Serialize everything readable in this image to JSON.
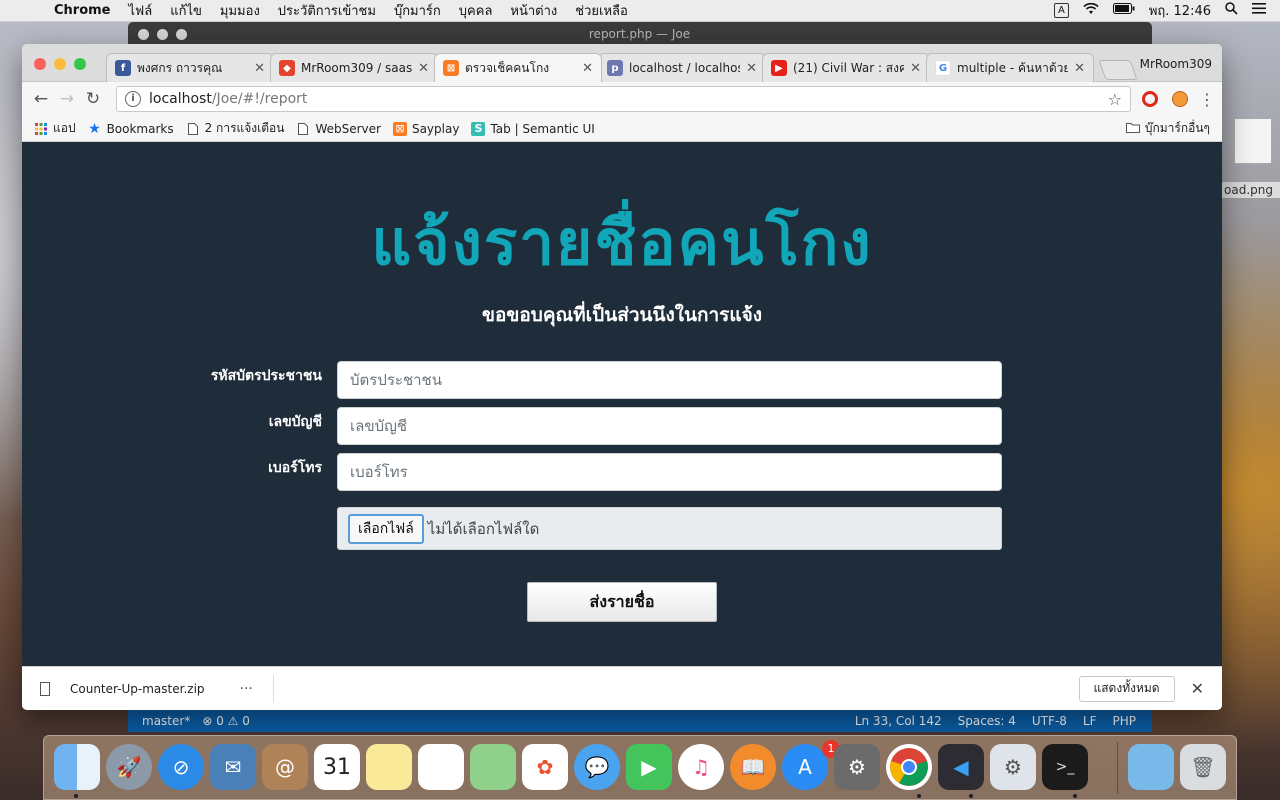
{
  "menubar": {
    "app": "Chrome",
    "items": [
      "ไฟล์",
      "แก้ไข",
      "มุมมอง",
      "ประวัติการเข้าชม",
      "บุ๊กมาร์ก",
      "บุคคล",
      "หน้าต่าง",
      "ช่วยเหลือ"
    ],
    "input_indicator": "A",
    "clock": "พฤ. 12:46"
  },
  "editor": {
    "title": "report.php — Joe",
    "status_left": [
      "master*",
      "⊗ 0 ⚠ 0"
    ],
    "status_right": [
      "Ln 33, Col 142",
      "Spaces: 4",
      "UTF-8",
      "LF",
      "PHP"
    ]
  },
  "chrome": {
    "profile": "MrRoom309",
    "tabs": [
      {
        "label": "พงศกร ถาวรคุณ",
        "icon": "facebook-icon",
        "color": "#3b5998"
      },
      {
        "label": "MrRoom309 / saas",
        "icon": "gitlab-icon",
        "color": "#e24329"
      },
      {
        "label": "ตรวจเช็คคนโกง",
        "icon": "xampp-icon",
        "color": "#fb7a24",
        "active": true
      },
      {
        "label": "localhost / localhos",
        "icon": "phpmyadmin-icon",
        "color": "#6c78af"
      },
      {
        "label": "(21) Civil War : สงคร",
        "icon": "youtube-icon",
        "color": "#e62117"
      },
      {
        "label": "multiple - ค้นหาด้วย",
        "icon": "google-icon",
        "color": "#4285f4"
      }
    ],
    "url_host": "localhost",
    "url_path": "/Joe/#!/report",
    "bookmarks": [
      {
        "label": "แอป",
        "icon": "apps-grid-icon"
      },
      {
        "label": "Bookmarks",
        "icon": "star-icon"
      },
      {
        "label": "2 การแจ้งเตือน",
        "icon": "page-icon"
      },
      {
        "label": "WebServer",
        "icon": "page-icon"
      },
      {
        "label": "Sayplay",
        "icon": "xampp-icon"
      },
      {
        "label": "Tab | Semantic UI",
        "icon": "semantic-icon"
      }
    ],
    "other_bookmarks": "บุ๊กมาร์กอื่นๆ"
  },
  "page": {
    "heading": "แจ้งรายชื่อคนโกง",
    "subheading": "ขอขอบคุณที่เป็นส่วนนึงในการแจ้ง",
    "fields": [
      {
        "label": "รหัสบัตรประชาชน",
        "placeholder": "บัตรประชาชน"
      },
      {
        "label": "เลขบัญชี",
        "placeholder": "เลขบัญชี"
      },
      {
        "label": "เบอร์โทร",
        "placeholder": "เบอร์โทร"
      }
    ],
    "file_button": "เลือกไฟล์",
    "file_status": "ไม่ได้เลือกไฟล์ใด",
    "submit": "ส่งรายชื่อ"
  },
  "download": {
    "filename": "Counter-Up-master.zip",
    "more": "···",
    "show_all": "แสดงทั้งหมด"
  },
  "desktop": {
    "file_label": "oad.png"
  },
  "dock": {
    "calendar_day": "31",
    "appstore_badge": "1"
  }
}
